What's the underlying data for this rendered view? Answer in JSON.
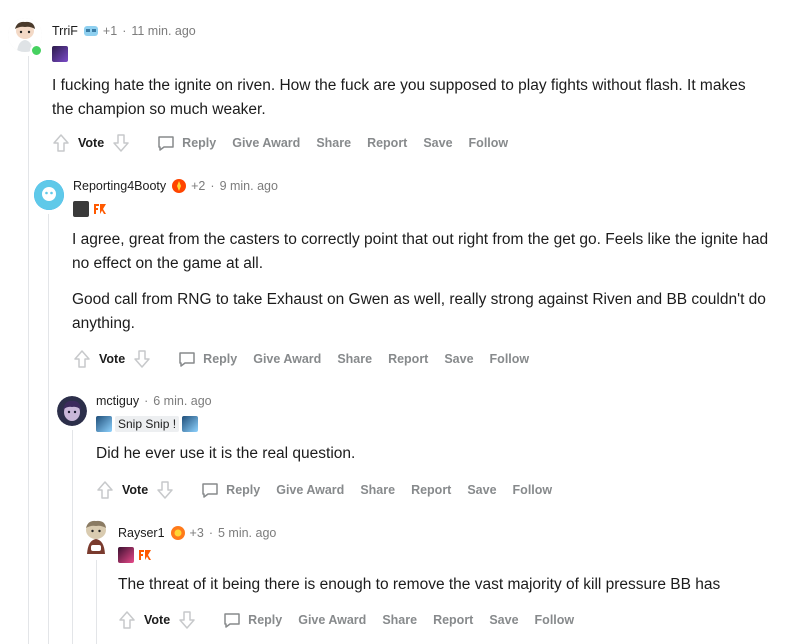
{
  "colors": {
    "thread_line": "#e3e5e8",
    "online": "#46d160",
    "muted": "#878a8c",
    "fnatic_orange": "#ff5900"
  },
  "comments": [
    {
      "username": "TrriF",
      "karma_badge": "+1",
      "time": "11 min. ago",
      "body": [
        "I fucking hate the ignite on riven. How the fuck are you supposed to play fights without flash. It makes the champion so much weaker."
      ]
    },
    {
      "username": "Reporting4Booty",
      "karma_badge": "+2",
      "time": "9 min. ago",
      "body": [
        "I agree, great from the casters to correctly point that out right from the get go. Feels like the ignite had no effect on the game at all.",
        "Good call from RNG to take Exhaust on Gwen as well, really strong against Riven and BB couldn't do anything."
      ]
    },
    {
      "username": "mctiguy",
      "time": "6 min. ago",
      "flair_text": "Snip Snip !",
      "body": [
        "Did he ever use it is the real question."
      ]
    },
    {
      "username": "Rayser1",
      "karma_badge": "+3",
      "time": "5 min. ago",
      "body": [
        "The threat of it being there is enough to remove the vast majority of kill pressure BB has"
      ]
    }
  ],
  "actions": {
    "vote": "Vote",
    "reply": "Reply",
    "give_award": "Give Award",
    "share": "Share",
    "report": "Report",
    "save": "Save",
    "follow": "Follow"
  },
  "separator": "·"
}
